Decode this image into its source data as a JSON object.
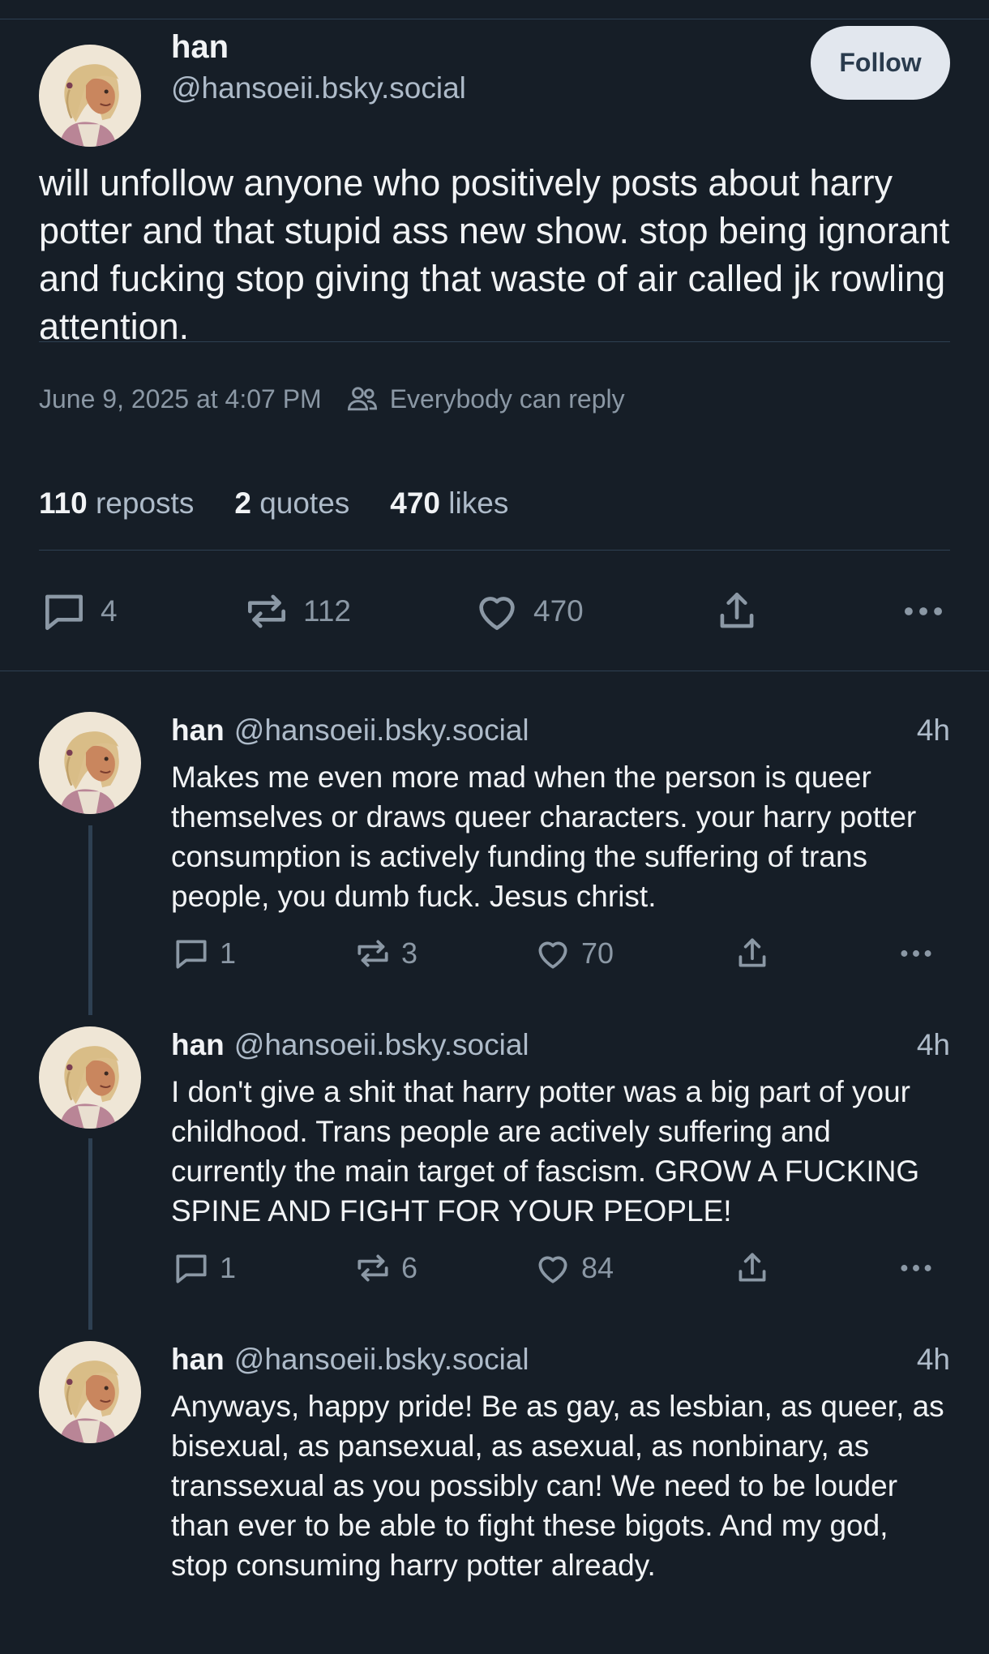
{
  "post": {
    "author_name": "han",
    "author_handle": "@hansoeii.bsky.social",
    "follow_label": "Follow",
    "text": "will unfollow anyone who positively posts about harry potter and that stupid ass new show. stop being ignorant and fucking stop giving that waste of air called jk rowling attention.",
    "timestamp": "June 9, 2025 at 4:07 PM",
    "reply_setting": "Everybody can reply",
    "reposts_count": "110",
    "reposts_label": "reposts",
    "quotes_count": "2",
    "quotes_label": "quotes",
    "likes_count": "470",
    "likes_label": "likes",
    "actions": {
      "replies": "4",
      "reposts": "112",
      "likes": "470"
    }
  },
  "replies": [
    {
      "name": "han",
      "handle": "@hansoeii.bsky.social",
      "time": "4h",
      "text": "Makes me even more mad when the person is queer themselves or draws queer characters. your harry potter consumption is actively funding the suffering of trans people, you dumb fuck. Jesus christ.",
      "replies": "1",
      "reposts": "3",
      "likes": "70"
    },
    {
      "name": "han",
      "handle": "@hansoeii.bsky.social",
      "time": "4h",
      "text": "I don't give a shit that harry potter was a big part of your childhood. Trans people are actively suffering and currently the main target of fascism. GROW A FUCKING SPINE AND FIGHT FOR YOUR PEOPLE!",
      "replies": "1",
      "reposts": "6",
      "likes": "84"
    },
    {
      "name": "han",
      "handle": "@hansoeii.bsky.social",
      "time": "4h",
      "text": "Anyways, happy pride! Be as gay, as lesbian, as queer, as bisexual, as pansexual, as asexual, as nonbinary, as transsexual as you possibly can! We need to be louder than ever to be able to fight these bigots. And my god, stop consuming harry potter already."
    }
  ],
  "colors": {
    "background": "#161e27",
    "text": "#f1f3f5",
    "secondary_text": "#aebbc9",
    "icon": "#8b98a5",
    "divider": "#2e4052",
    "follow_button_bg": "#e2e7ee"
  }
}
